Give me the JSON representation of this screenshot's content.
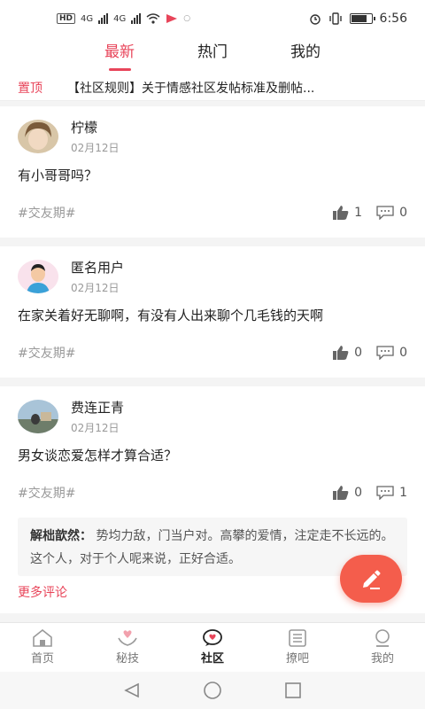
{
  "status_bar": {
    "left_badges": [
      "HD",
      "4G",
      "4G"
    ],
    "time": "6:56",
    "battery_level": 0.85
  },
  "tabs": [
    {
      "label": "最新",
      "active": true
    },
    {
      "label": "热门",
      "active": false
    },
    {
      "label": "我的",
      "active": false
    }
  ],
  "pinned": {
    "tag": "置顶",
    "text": "【社区规则】关于情感社区发帖标准及删帖..."
  },
  "posts": [
    {
      "author": "柠檬",
      "date": "02月12日",
      "content": "有小哥哥吗？",
      "topic": "#交友期#",
      "likes": "1",
      "comments": "0"
    },
    {
      "author": "匿名用户",
      "date": "02月12日",
      "content": "在家关着好无聊啊，有没有人出来聊个几毛钱的天啊",
      "topic": "#交友期#",
      "likes": "0",
      "comments": "0"
    },
    {
      "author": "费连正青",
      "date": "02月12日",
      "content": "男女谈恋爱怎样才算合适？",
      "topic": "#交友期#",
      "likes": "0",
      "comments": "1",
      "comment": {
        "name": "解柮歆然：",
        "text": " 势均力敌，门当户对。高攀的爱情，注定走不长远的。这个人，对于个人呢来说，正好合适。"
      },
      "more_label": "更多评论"
    }
  ],
  "bottom_nav": [
    {
      "label": "首页",
      "icon": "home-icon",
      "active": false
    },
    {
      "label": "秘技",
      "icon": "heart-hands-icon",
      "active": false
    },
    {
      "label": "社区",
      "icon": "community-icon",
      "active": true
    },
    {
      "label": "撩吧",
      "icon": "list-icon",
      "active": false
    },
    {
      "label": "我的",
      "icon": "user-icon",
      "active": false
    }
  ],
  "colors": {
    "accent": "#e8455a",
    "fab": "#f45d4c"
  }
}
